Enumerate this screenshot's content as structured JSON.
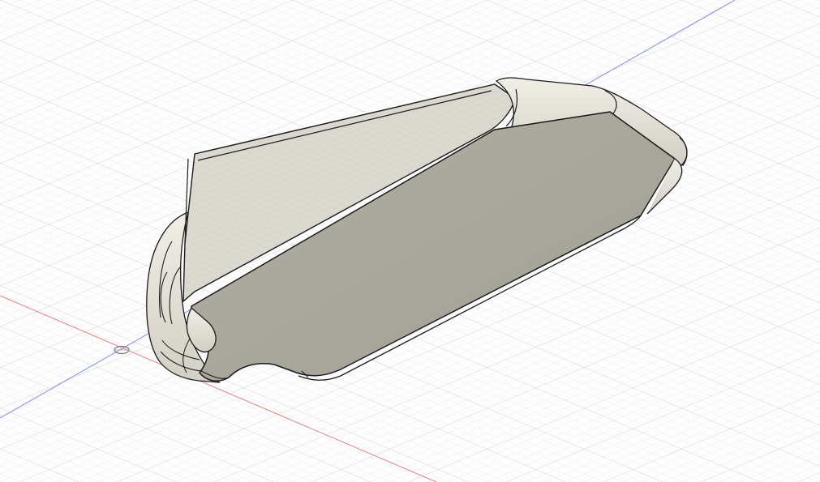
{
  "viewport": {
    "background_color": "#fdfdfd",
    "grid_minor_color": "#e3e6e9",
    "grid_major_color": "#c8cdd2",
    "x_axis_color": "#e8817f",
    "y_axis_color": "#7d8cf0"
  },
  "model": {
    "body_color": "#a8a59a",
    "top_face_color": "#dcdad0",
    "fillet_color": "#e6e3da",
    "edge_color": "#1b1b1b",
    "origin_marker_icon": "origin-point-icon"
  }
}
